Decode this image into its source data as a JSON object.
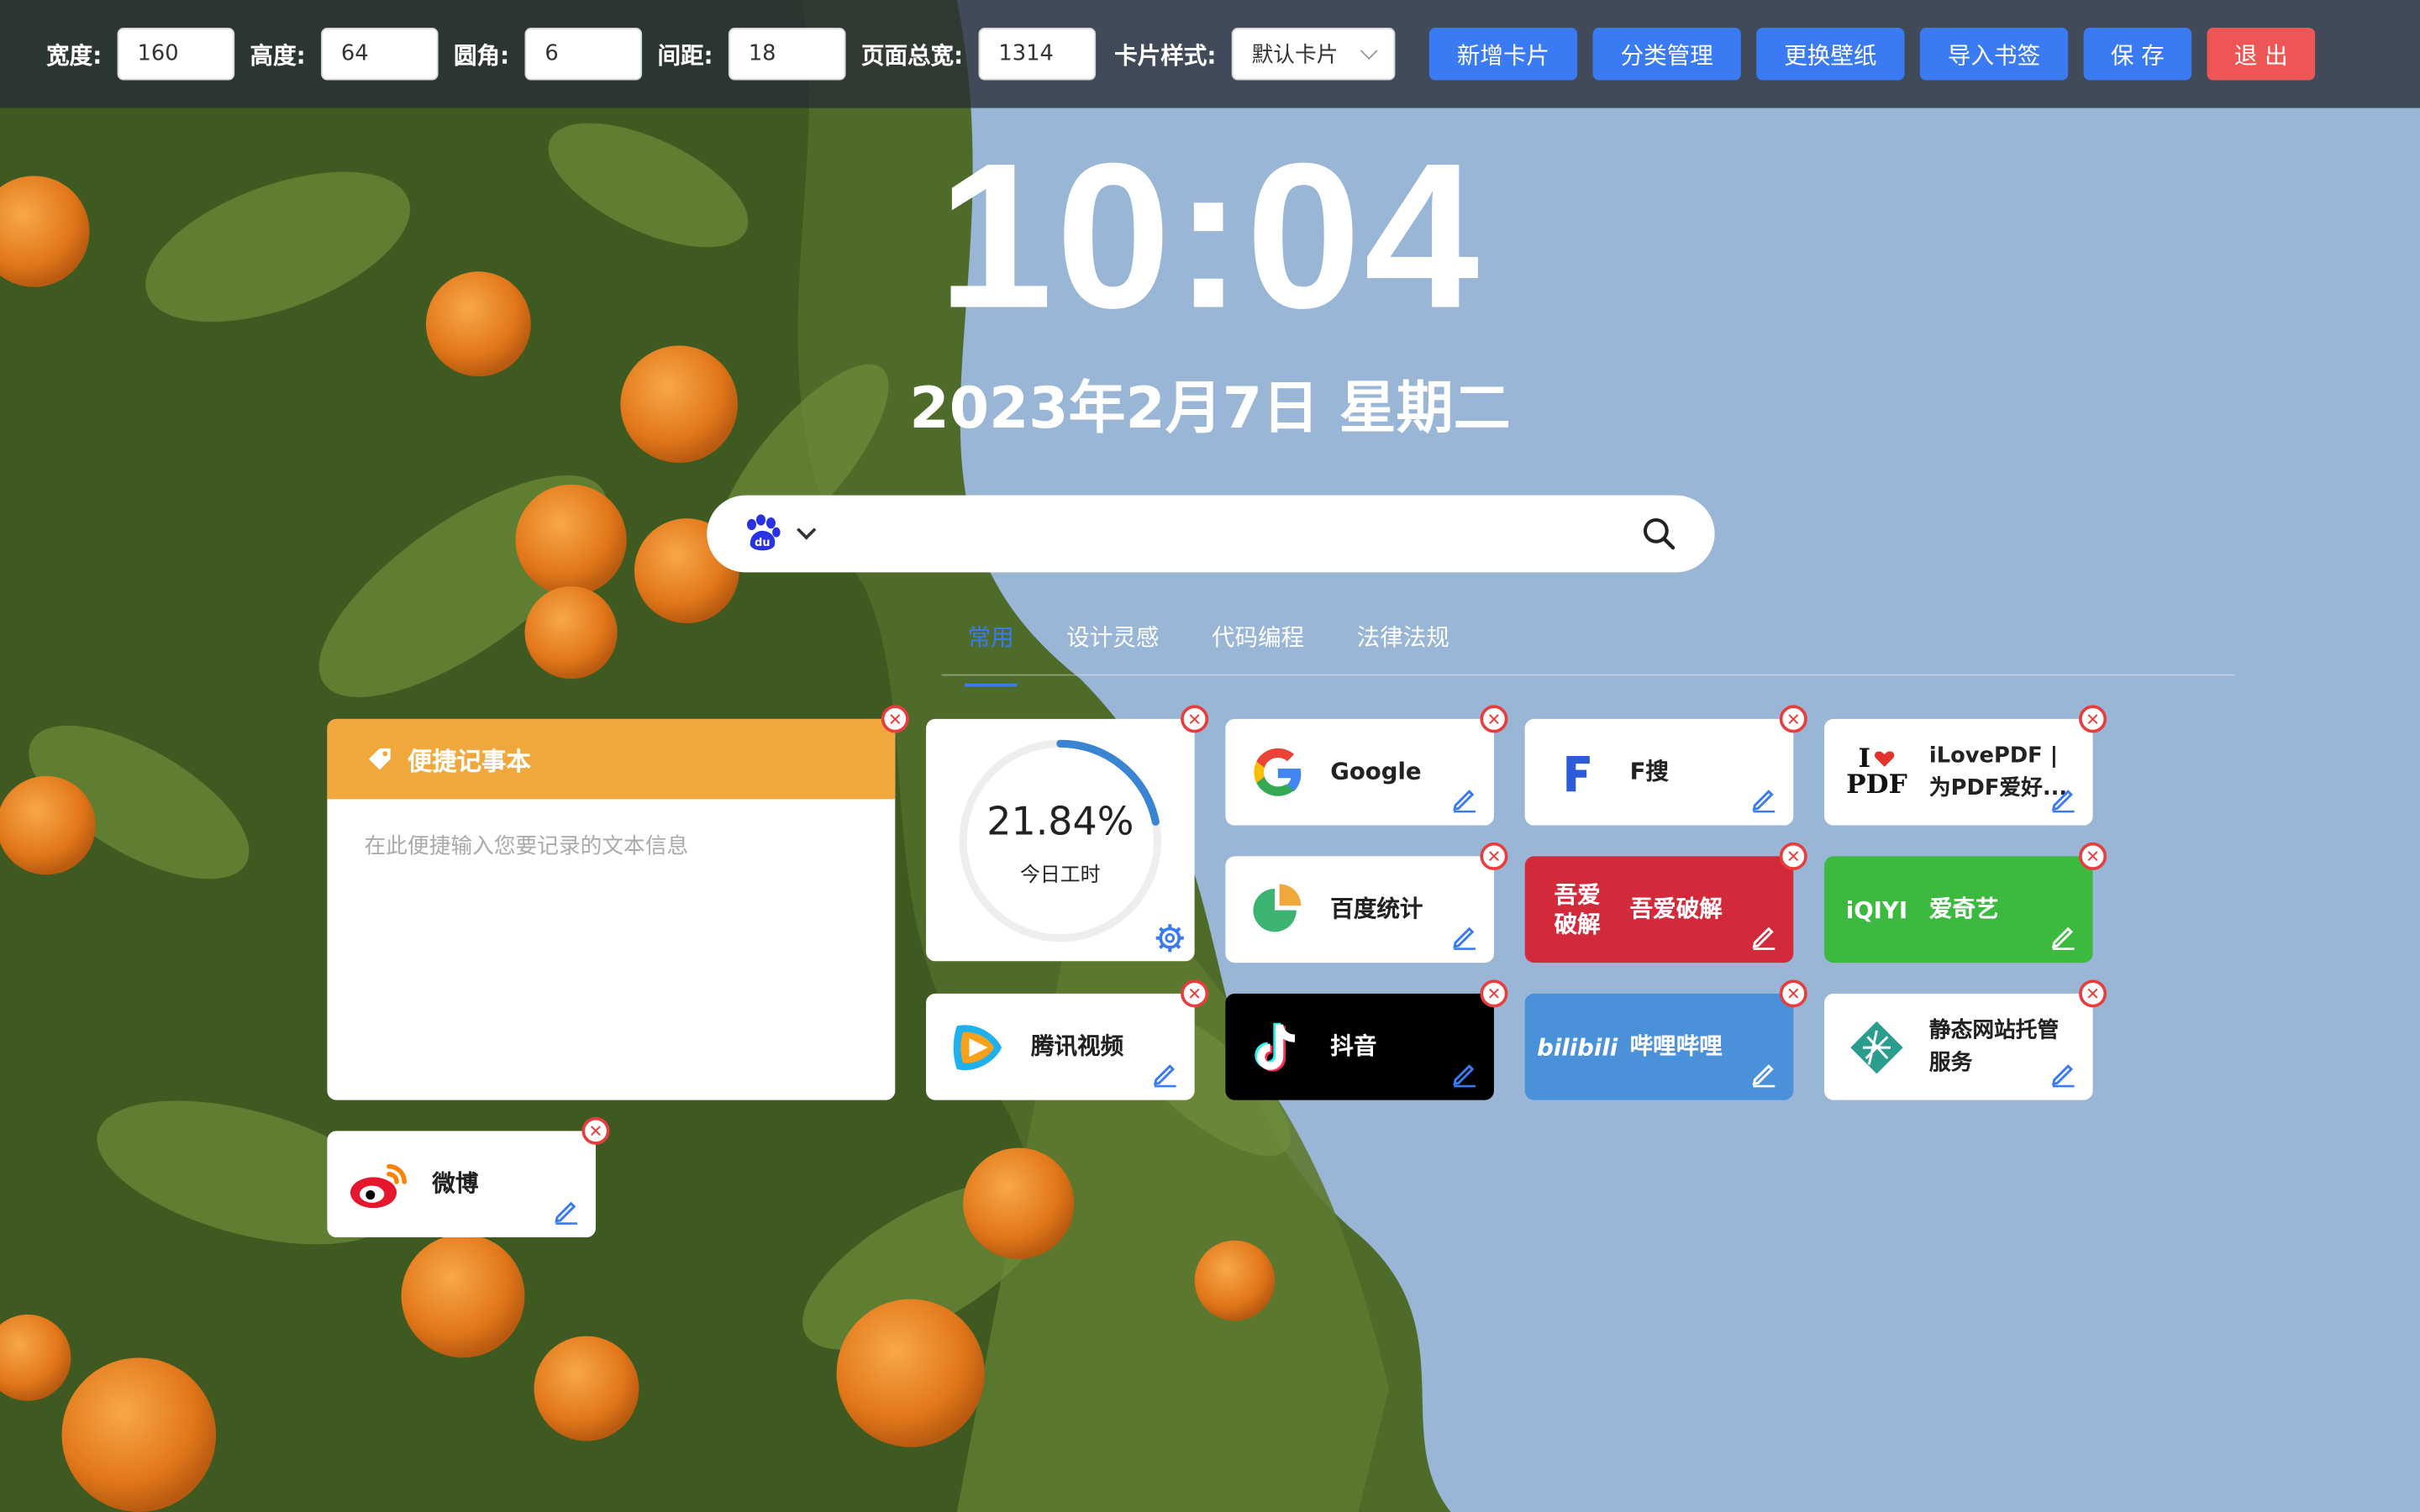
{
  "toolbar": {
    "width_label": "宽度:",
    "width_value": "160",
    "height_label": "高度:",
    "height_value": "64",
    "radius_label": "圆角:",
    "radius_value": "6",
    "gap_label": "间距:",
    "gap_value": "18",
    "page_width_label": "页面总宽:",
    "page_width_value": "1314",
    "card_style_label": "卡片样式:",
    "card_style_value": "默认卡片",
    "buttons": {
      "add_card": "新增卡片",
      "category": "分类管理",
      "wallpaper": "更换壁纸",
      "import": "导入书签",
      "save": "保 存",
      "exit": "退 出"
    }
  },
  "clock": {
    "time": "10:04",
    "date": "2023年2月7日 星期二"
  },
  "search": {
    "engine_logo": "du",
    "placeholder": ""
  },
  "tabs": [
    "常用",
    "设计灵感",
    "代码编程",
    "法律法规"
  ],
  "note": {
    "title": "便捷记事本",
    "placeholder": "在此便捷输入您要记录的文本信息"
  },
  "progress": {
    "percent": "21.84%",
    "label": "今日工时",
    "fraction": 0.2184
  },
  "sites": {
    "google": "Google",
    "fsou": "F搜",
    "ilovepdf": "iLovePDF | 为PDF爱好...",
    "ilovepdf_logo_top": "I",
    "ilovepdf_logo_bottom": "PDF",
    "baidutongji": "百度统计",
    "wuai": "吾爱破解",
    "wuai_logo": "吾爱破解",
    "iqiyi": "爱奇艺",
    "iqiyi_logo": "iQIYI",
    "tencent": "腾讯视频",
    "douyin": "抖音",
    "bilibili": "哔哩哔哩",
    "bilibili_logo": "bilibili",
    "netlify": "静态网站托管服务",
    "weibo": "微博"
  },
  "colors": {
    "accent": "#3a7bf3",
    "danger": "#ee5656",
    "note_header": "#f0a73b",
    "douyin_bg": "#000000",
    "wuai_bg": "#d2293b",
    "iqiyi_bg": "#3cba3f",
    "bilibili_bg": "#4a91d9"
  },
  "icons": {
    "search": "search-icon",
    "close": "close-icon",
    "edit": "edit-icon",
    "settings": "gear-icon",
    "tag": "tag-icon"
  }
}
